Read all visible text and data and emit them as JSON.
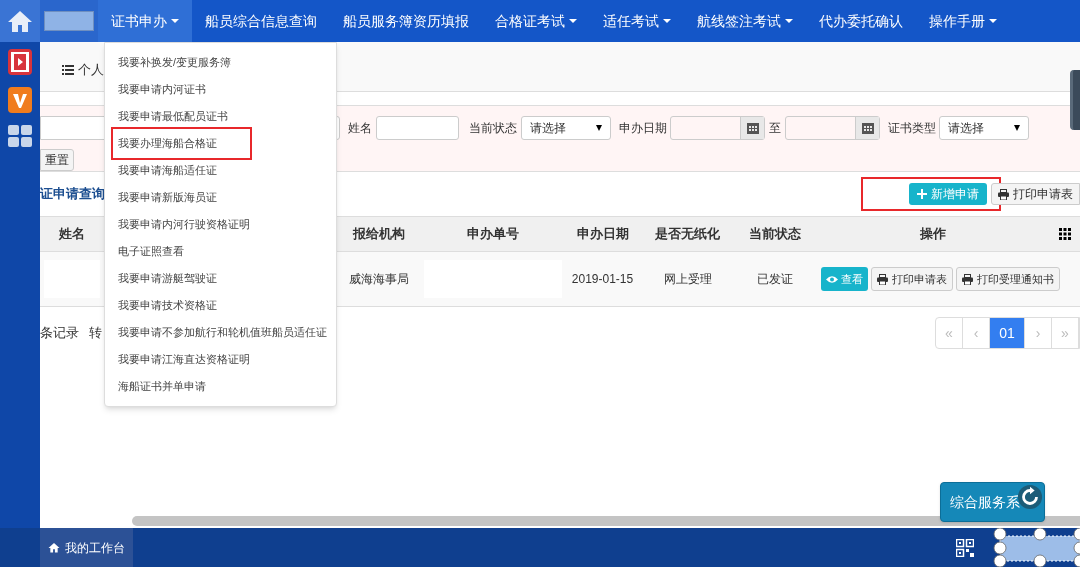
{
  "nav": {
    "items": [
      {
        "label": "证书申办",
        "has_caret": true,
        "selected": true
      },
      {
        "label": "船员综合信息查询",
        "has_caret": false,
        "selected": false
      },
      {
        "label": "船员服务簿资历填报",
        "has_caret": false,
        "selected": false
      },
      {
        "label": "合格证考试",
        "has_caret": true,
        "selected": false
      },
      {
        "label": "适任考试",
        "has_caret": true,
        "selected": false
      },
      {
        "label": "航线签注考试",
        "has_caret": true,
        "selected": false
      },
      {
        "label": "代办委托确认",
        "has_caret": false,
        "selected": false
      },
      {
        "label": "操作手册",
        "has_caret": true,
        "selected": false
      }
    ]
  },
  "dropdown": {
    "items": [
      {
        "label": "我要补换发/变更服务簿",
        "highlighted": false
      },
      {
        "label": "我要申请内河证书",
        "highlighted": false
      },
      {
        "label": "我要申请最低配员证书",
        "highlighted": false
      },
      {
        "label": "我要办理海船合格证",
        "highlighted": true
      },
      {
        "label": "我要申请海船适任证",
        "highlighted": false
      },
      {
        "label": "我要申请新版海员证",
        "highlighted": false
      },
      {
        "label": "我要申请内河行驶资格证明",
        "highlighted": false
      },
      {
        "label": "电子证照查看",
        "highlighted": false
      },
      {
        "label": "我要申请游艇驾驶证",
        "highlighted": false
      },
      {
        "label": "我要申请技术资格证",
        "highlighted": false
      },
      {
        "label": "我要申请不参加航行和轮机值班船员适任证",
        "highlighted": false
      },
      {
        "label": "我要申请江海直达资格证明",
        "highlighted": false
      },
      {
        "label": "海船证书并单申请",
        "highlighted": false
      }
    ]
  },
  "tab": {
    "label": "个人"
  },
  "filters": {
    "name_label": "姓名",
    "status_label": "当前状态",
    "status_value": "请选择",
    "date_label": "申办日期",
    "date_to": "至",
    "type_label": "证书类型",
    "type_value": "请选择",
    "reset_button": "重置"
  },
  "section": {
    "title": "证申请查询",
    "new_button": {
      "label": "新增申请",
      "highlighted": true
    },
    "print_button": "打印申请表"
  },
  "table": {
    "columns": [
      "姓名",
      "报给机构",
      "申办单号",
      "申办日期",
      "是否无纸化",
      "当前状态",
      "操作"
    ],
    "rows": [
      {
        "agency": "威海海事局",
        "date": "2019-01-15",
        "paperless": "网上受理",
        "status": "已发证",
        "actions": [
          {
            "label": "查看",
            "kind": "view"
          },
          {
            "label": "打印申请表",
            "kind": "print"
          },
          {
            "label": "打印受理通知书",
            "kind": "print"
          }
        ]
      }
    ]
  },
  "footer": {
    "records": "条记录",
    "goto": "转"
  },
  "pagination": [
    {
      "label": "«",
      "selected": false
    },
    {
      "label": "‹",
      "selected": false
    },
    {
      "label": "01",
      "selected": true
    },
    {
      "label": "›",
      "selected": false
    },
    {
      "label": "»",
      "selected": false
    }
  ],
  "float_button": "综合服务系",
  "status_bar": {
    "home": "我的工作台"
  }
}
